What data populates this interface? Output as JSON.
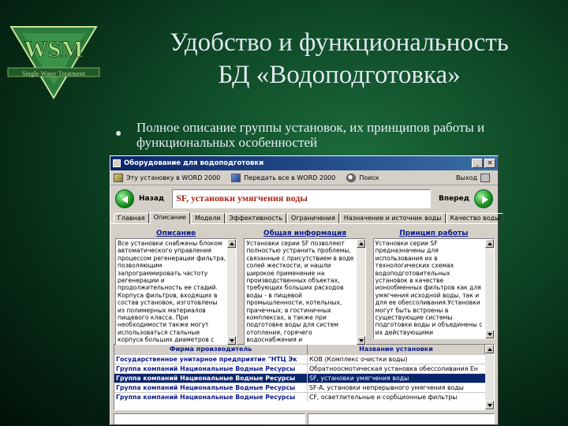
{
  "slide": {
    "logo_text": "Single Water Treatment",
    "title_line1": "Удобство и функциональность",
    "title_line2": "БД «Водоподготовка»",
    "bullet": "Полное описание группы установок, их принципов работы и функциональных особенностей"
  },
  "window": {
    "title": "Оборудование для водоподготовки",
    "toolbar": {
      "export_one": "Эту установку в WORD 2000",
      "export_all": "Передать все в WORD 2000",
      "search": "Поиск",
      "exit": "Выход"
    },
    "nav": {
      "back": "Назад",
      "forward": "Вперед",
      "current": "SF, установки умягчения воды"
    },
    "tabs": [
      "Главная",
      "Описание",
      "Модели",
      "Эффективность",
      "Ограничения",
      "Назначение и источник воды",
      "Качество воды"
    ],
    "active_tab": 1,
    "panels": [
      {
        "heading": "Описание",
        "text": "Все установки снабжены блоком автоматического управления процессом регенерации фильтра, позволяющим запрограммировать частоту регенерации и продолжительность ее стадий. Корпуса фильтров, входящих в состав установок, изготовлены из полимерных материалов пищевого класса. При необходимости также могут использоваться стальные корпуса больших диаметров с"
      },
      {
        "heading": "Общая информация",
        "text": "Установки серии SF позволяют полностью устранить проблемы, связанные с присутствием в воде солей жесткости, и нашли широкое применение на производственных объектах, требующих больших расходов воды - в пищевой промышленности, котельных, прачечных; в гостиничных комплексах, а также при подготовке воды для систем отопления, горячего водоснабжения и"
      },
      {
        "heading": "Принцип работы",
        "text": "Установки серии SF предназначены для использования их в технологических схемах водоподготовительных установок в качестве ионообменных фильтров как для умягчения исходной воды, так и для ее обессоливания.Установки могут быть встроены в существующие системы подготовки воды и объединены с их действующими"
      }
    ],
    "table": {
      "headers": [
        "Фирма производитель",
        "Название установки"
      ],
      "rows": [
        {
          "firm": "Государственное унитарное предприятие \"НТЦ Эк",
          "name": "КОВ (Комплекс очистки воды)",
          "selected": false
        },
        {
          "firm": "Группа компаний Национальные Водные Ресурсы",
          "name": "Обратноосмотическая установка обессоливания Ен",
          "selected": false
        },
        {
          "firm": "Группа компаний Национальные Водные Ресурсы",
          "name": "SF, установки умягчения воды",
          "selected": true
        },
        {
          "firm": "Группа компаний Национальные Водные Ресурсы",
          "name": "SF-A, установки непрерывного умягчения воды",
          "selected": false
        },
        {
          "firm": "Группа компаний Национальные Водные Ресурсы",
          "name": "CF, осветлительные и сорбционные фильтры",
          "selected": false
        }
      ]
    }
  }
}
